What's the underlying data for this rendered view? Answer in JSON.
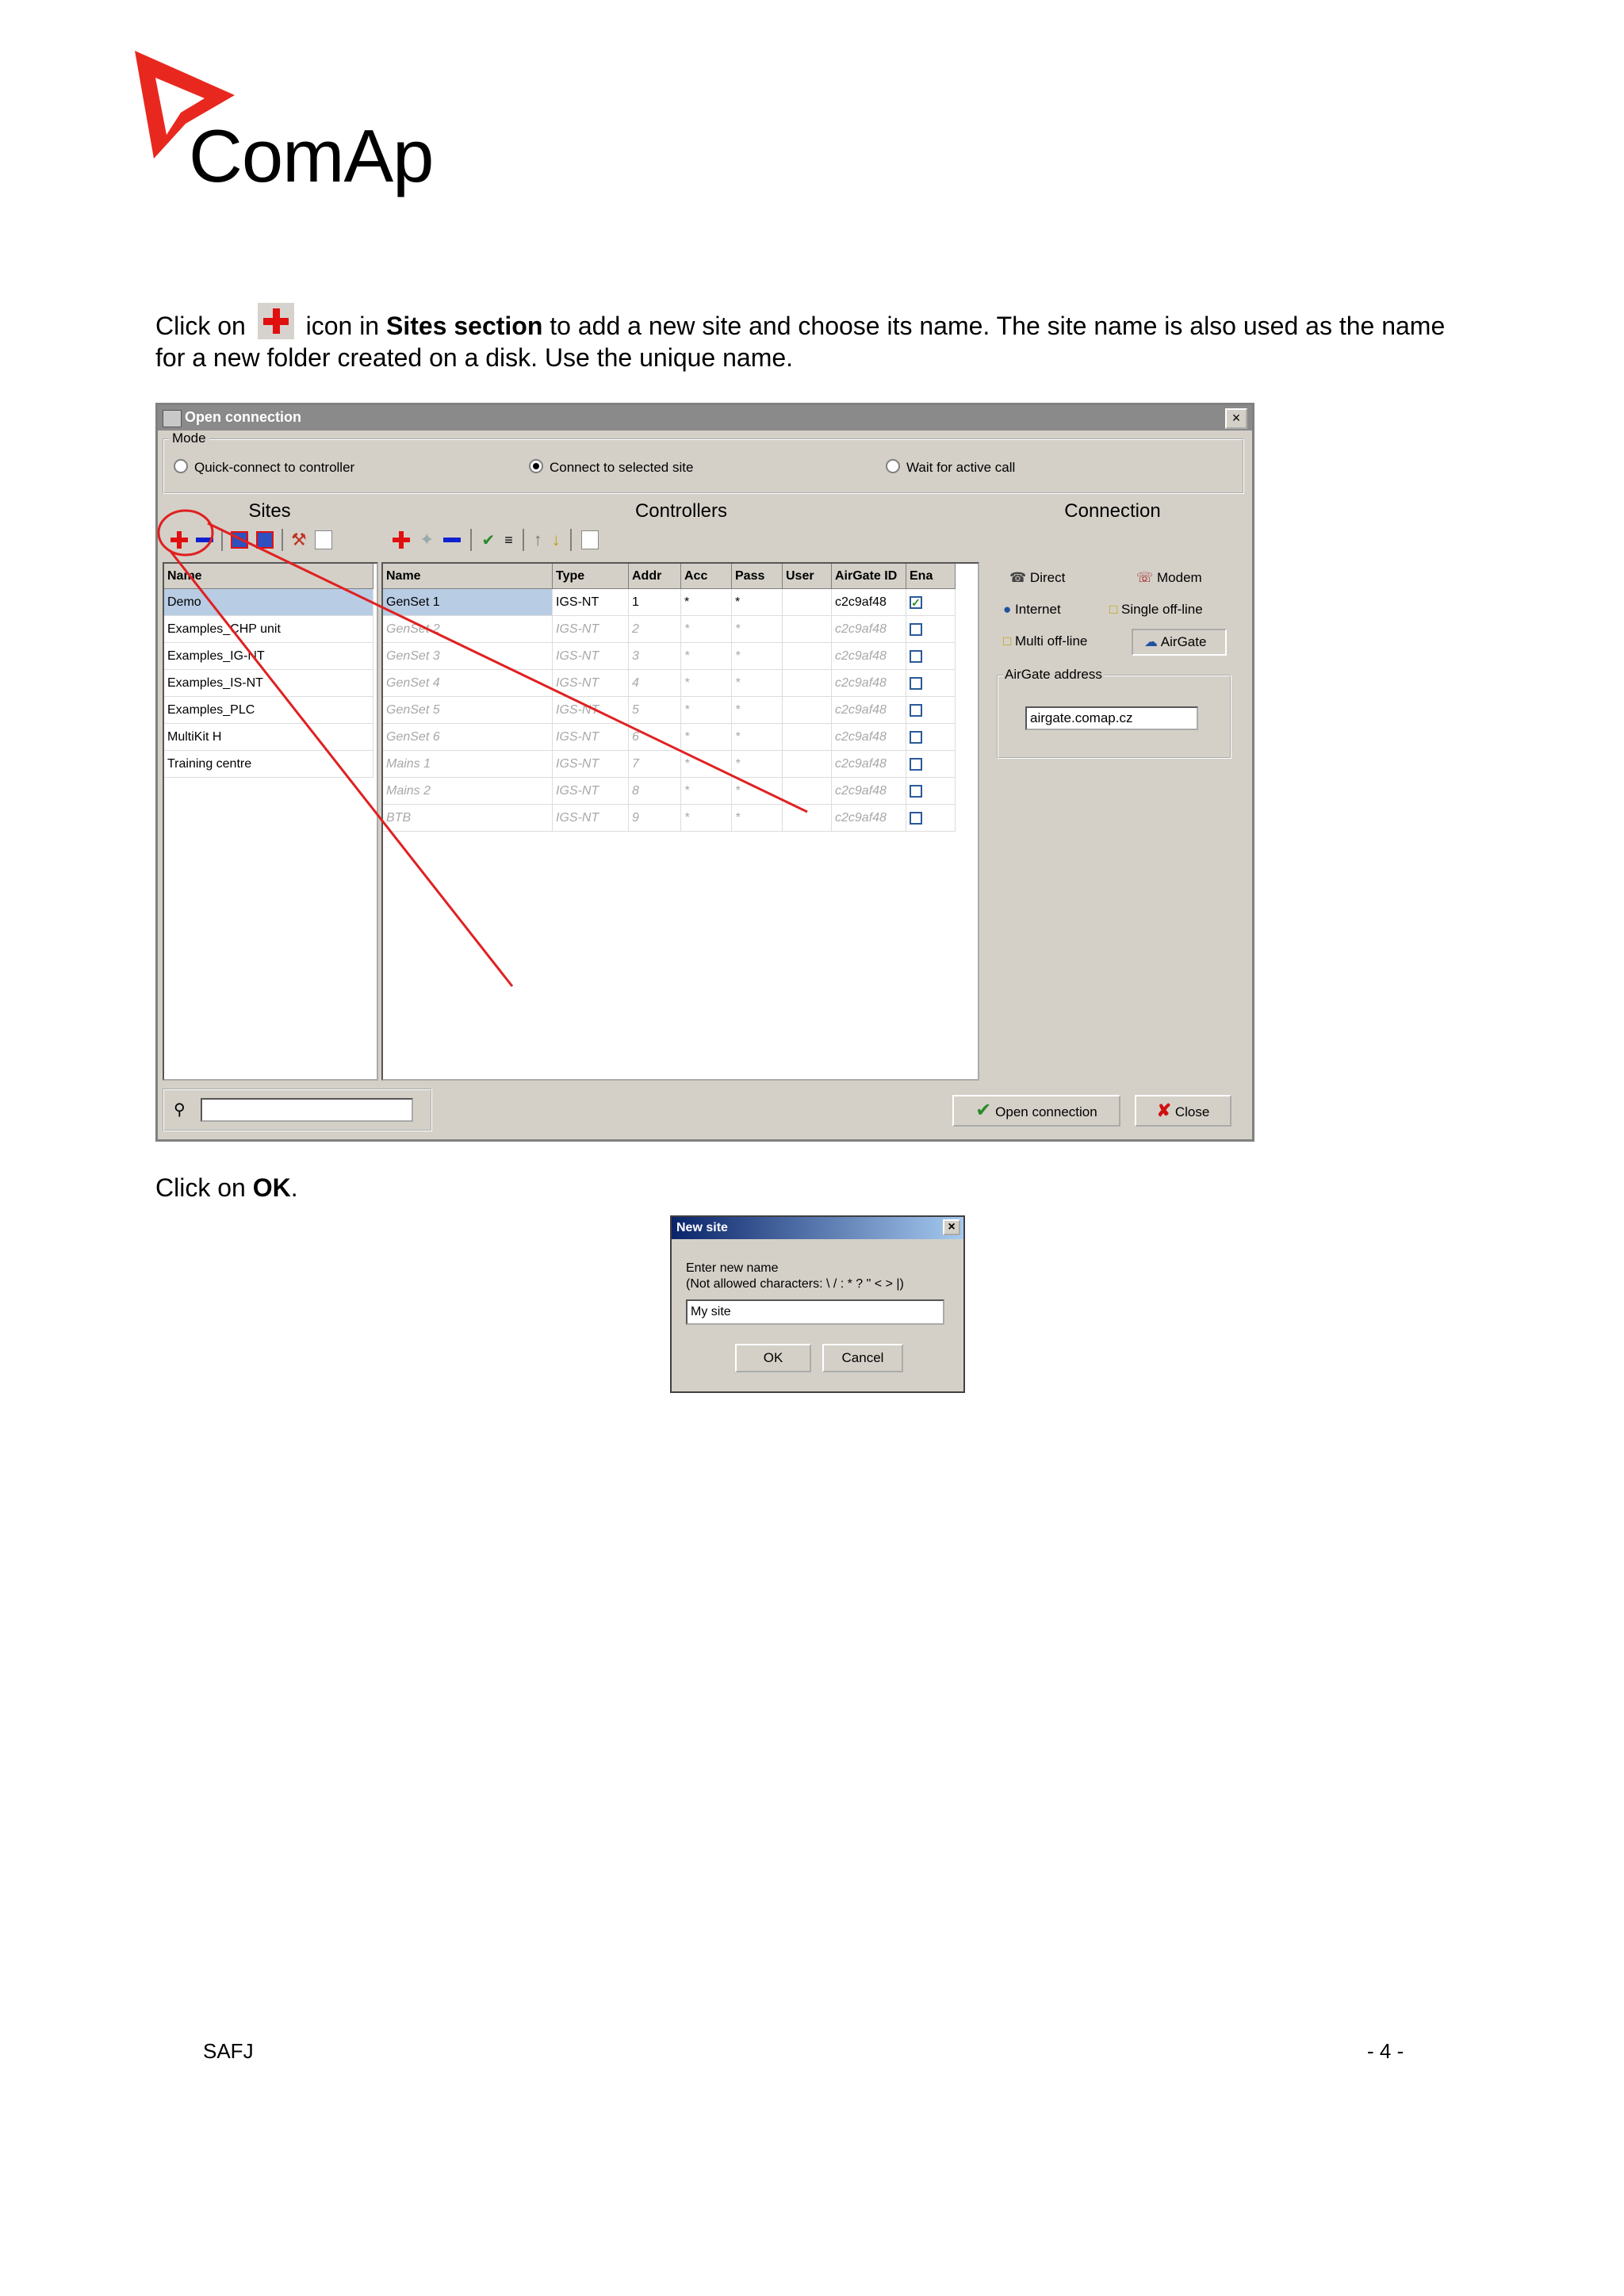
{
  "logo": {
    "text": "ComAp"
  },
  "intro": {
    "before": "Click on",
    "after_icon": "icon in",
    "bold": "Sites section",
    "rest": "to add a new site and choose its name. The site name is also used as the name for a new folder created on a disk. Use the unique name."
  },
  "window": {
    "title": "Open connection",
    "close_glyph": "×",
    "mode": {
      "label": "Mode",
      "options": [
        "Quick-connect to controller",
        "Connect to selected site",
        "Wait for active call"
      ],
      "selected": "Connect to selected site"
    },
    "sites": {
      "title": "Sites",
      "header": "Name",
      "items": [
        "Demo",
        "Examples_CHP unit",
        "Examples_IG-NT",
        "Examples_IS-NT",
        "Examples_PLC",
        "MultiKit H",
        "Training centre"
      ],
      "selected": "Demo"
    },
    "controllers": {
      "title": "Controllers",
      "columns": [
        "Name",
        "Type",
        "Addr",
        "Acc",
        "Pass",
        "User",
        "AirGate ID",
        "Ena"
      ],
      "rows": [
        {
          "name": "GenSet 1",
          "type": "IGS-NT",
          "addr": "1",
          "acc": "*",
          "pass": "*",
          "user": "",
          "airgate": "c2c9af48",
          "ena": true
        },
        {
          "name": "GenSet 2",
          "type": "IGS-NT",
          "addr": "2",
          "acc": "*",
          "pass": "*",
          "user": "",
          "airgate": "c2c9af48",
          "ena": false
        },
        {
          "name": "GenSet 3",
          "type": "IGS-NT",
          "addr": "3",
          "acc": "*",
          "pass": "*",
          "user": "",
          "airgate": "c2c9af48",
          "ena": false
        },
        {
          "name": "GenSet 4",
          "type": "IGS-NT",
          "addr": "4",
          "acc": "*",
          "pass": "*",
          "user": "",
          "airgate": "c2c9af48",
          "ena": false
        },
        {
          "name": "GenSet 5",
          "type": "IGS-NT",
          "addr": "5",
          "acc": "*",
          "pass": "*",
          "user": "",
          "airgate": "c2c9af48",
          "ena": false
        },
        {
          "name": "GenSet 6",
          "type": "IGS-NT",
          "addr": "6",
          "acc": "*",
          "pass": "*",
          "user": "",
          "airgate": "c2c9af48",
          "ena": false
        },
        {
          "name": "Mains 1",
          "type": "IGS-NT",
          "addr": "7",
          "acc": "*",
          "pass": "*",
          "user": "",
          "airgate": "c2c9af48",
          "ena": false
        },
        {
          "name": "Mains 2",
          "type": "IGS-NT",
          "addr": "8",
          "acc": "*",
          "pass": "*",
          "user": "",
          "airgate": "c2c9af48",
          "ena": false
        },
        {
          "name": "BTB",
          "type": "IGS-NT",
          "addr": "9",
          "acc": "*",
          "pass": "*",
          "user": "",
          "airgate": "c2c9af48",
          "ena": false
        }
      ]
    },
    "connection": {
      "title": "Connection",
      "types": [
        "Direct",
        "Modem",
        "Internet",
        "Single off-line",
        "Multi off-line",
        "AirGate"
      ],
      "selected": "AirGate",
      "airgate_label": "AirGate address",
      "airgate_value": "airgate.comap.cz"
    },
    "bottom": {
      "open_label": "Open connection",
      "close_label": "Close"
    }
  },
  "dialog": {
    "title": "New site",
    "prompt1": "Enter new name",
    "prompt2": "(Not allowed characters: \\ / : * ? \" < > |)",
    "value": "My site",
    "ok": "OK",
    "cancel": "Cancel"
  },
  "outro": {
    "before": "Click on",
    "bold": "OK",
    "after": "."
  },
  "footer": {
    "left": "SAFJ",
    "right": "- 4 -"
  },
  "colors": {
    "annotation": "#e02020",
    "logo_red": "#e8281e",
    "selection": "#b8cce4"
  }
}
